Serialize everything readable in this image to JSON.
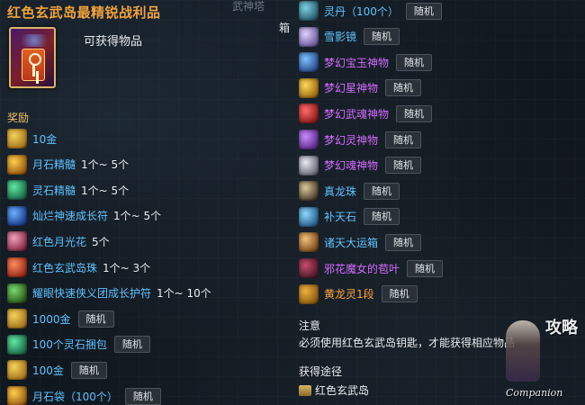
{
  "title": "红色玄武岛最精锐战利品",
  "subtitle": "可获得物品",
  "reward_label": "奖励",
  "map_text": "武神塔",
  "box_char": "箱",
  "left_items": [
    {
      "icon": "gold-ingot-icon",
      "name": "10金",
      "qty": "",
      "badge": "",
      "color": "blue",
      "c1": "#f2d25a",
      "c2": "#a8741a"
    },
    {
      "icon": "moonstone-essence-icon",
      "name": "月石精髓",
      "qty": "1个~ 5个",
      "badge": "",
      "color": "blue",
      "c1": "#ffcf4a",
      "c2": "#9a5a10"
    },
    {
      "icon": "spirit-stone-essence-icon",
      "name": "灵石精髓",
      "qty": "1个~ 5个",
      "badge": "",
      "color": "blue",
      "c1": "#5ee8a0",
      "c2": "#1a6a4a"
    },
    {
      "icon": "growth-talisman-icon",
      "name": "灿烂神速成长符",
      "qty": "1个~ 5个",
      "badge": "",
      "color": "blue",
      "c1": "#6ab0ff",
      "c2": "#1a3a8a"
    },
    {
      "icon": "moonlight-flower-icon",
      "name": "红色月光花",
      "qty": "5个",
      "badge": "",
      "color": "blue",
      "c1": "#f0a0b8",
      "c2": "#8a2a4a"
    },
    {
      "icon": "island-bead-icon",
      "name": "红色玄武岛珠",
      "qty": "1个~ 3个",
      "badge": "",
      "color": "blue",
      "c1": "#ff8a5a",
      "c2": "#9a2a1a"
    },
    {
      "icon": "guild-amulet-icon",
      "name": "耀眼快速侠义团成长护符",
      "qty": "1个~ 10个",
      "badge": "",
      "color": "blue",
      "c1": "#7ad870",
      "c2": "#2a5a1a"
    },
    {
      "icon": "gold-ingot-icon",
      "name": "1000金",
      "qty": "",
      "badge": "随机",
      "color": "blue",
      "c1": "#f2d25a",
      "c2": "#a8741a"
    },
    {
      "icon": "spirit-stone-bundle-icon",
      "name": "100个灵石捆包",
      "qty": "",
      "badge": "随机",
      "color": "blue",
      "c1": "#5ee8a0",
      "c2": "#1a6a4a"
    },
    {
      "icon": "gold-ingot-icon",
      "name": "100金",
      "qty": "",
      "badge": "随机",
      "color": "blue",
      "c1": "#f2d25a",
      "c2": "#a8741a"
    },
    {
      "icon": "moonstone-bag-icon",
      "name": "月石袋（100个）",
      "qty": "",
      "badge": "随机",
      "color": "blue",
      "c1": "#ffcf4a",
      "c2": "#9a5a10"
    }
  ],
  "right_items": [
    {
      "icon": "elixir-icon",
      "name": "灵丹（100个）",
      "badge": "随机",
      "color": "blue",
      "c1": "#7ad0e0",
      "c2": "#2a5a6a"
    },
    {
      "icon": "snow-mirror-icon",
      "name": "雪影镜",
      "badge": "随机",
      "color": "blue",
      "c1": "#e0d0ff",
      "c2": "#6a5a9a"
    },
    {
      "icon": "dream-jade-artifact-icon",
      "name": "梦幻宝玉神物",
      "badge": "随机",
      "color": "purple",
      "c1": "#7ac0ff",
      "c2": "#2a4a8a"
    },
    {
      "icon": "dream-star-artifact-icon",
      "name": "梦幻星神物",
      "badge": "随机",
      "color": "purple",
      "c1": "#ffd85a",
      "c2": "#9a6a10"
    },
    {
      "icon": "dream-soul-artifact-icon",
      "name": "梦幻武魂神物",
      "badge": "随机",
      "color": "purple",
      "c1": "#ff6a6a",
      "c2": "#8a1a1a"
    },
    {
      "icon": "dream-spirit-artifact-icon",
      "name": "梦幻灵神物",
      "badge": "随机",
      "color": "purple",
      "c1": "#c88aff",
      "c2": "#5a2a8a"
    },
    {
      "icon": "dream-spirit-soul-artifact-icon",
      "name": "梦幻魂神物",
      "badge": "随机",
      "color": "purple",
      "c1": "#e8e8f0",
      "c2": "#6a6a7a"
    },
    {
      "icon": "dragon-pearl-icon",
      "name": "真龙珠",
      "badge": "随机",
      "color": "blue",
      "c1": "#d8c89a",
      "c2": "#4a3a2a"
    },
    {
      "icon": "sky-stone-icon",
      "name": "补天石",
      "badge": "随机",
      "color": "blue",
      "c1": "#8ad8ff",
      "c2": "#2a5a8a"
    },
    {
      "icon": "fortune-chest-icon",
      "name": "诸天大运箱",
      "badge": "随机",
      "color": "blue",
      "c1": "#f0c07a",
      "c2": "#7a4a1a"
    },
    {
      "icon": "fairy-leaf-icon",
      "name": "邪花魔女的苞叶",
      "badge": "随机",
      "color": "purple",
      "c1": "#c84a6a",
      "c2": "#4a1a2a"
    },
    {
      "icon": "yellow-dragon-spirit-icon",
      "name": "黄龙灵1段",
      "badge": "随机",
      "color": "orange",
      "c1": "#f0b040",
      "c2": "#8a5a10"
    }
  ],
  "note": {
    "heading": "注意",
    "text": "必须使用红色玄武岛钥匙，才能获得相应物品"
  },
  "source": {
    "heading": "获得途径",
    "item": "红色玄武岛"
  },
  "companion": {
    "glyphs": "攻略",
    "label": "Companion"
  }
}
